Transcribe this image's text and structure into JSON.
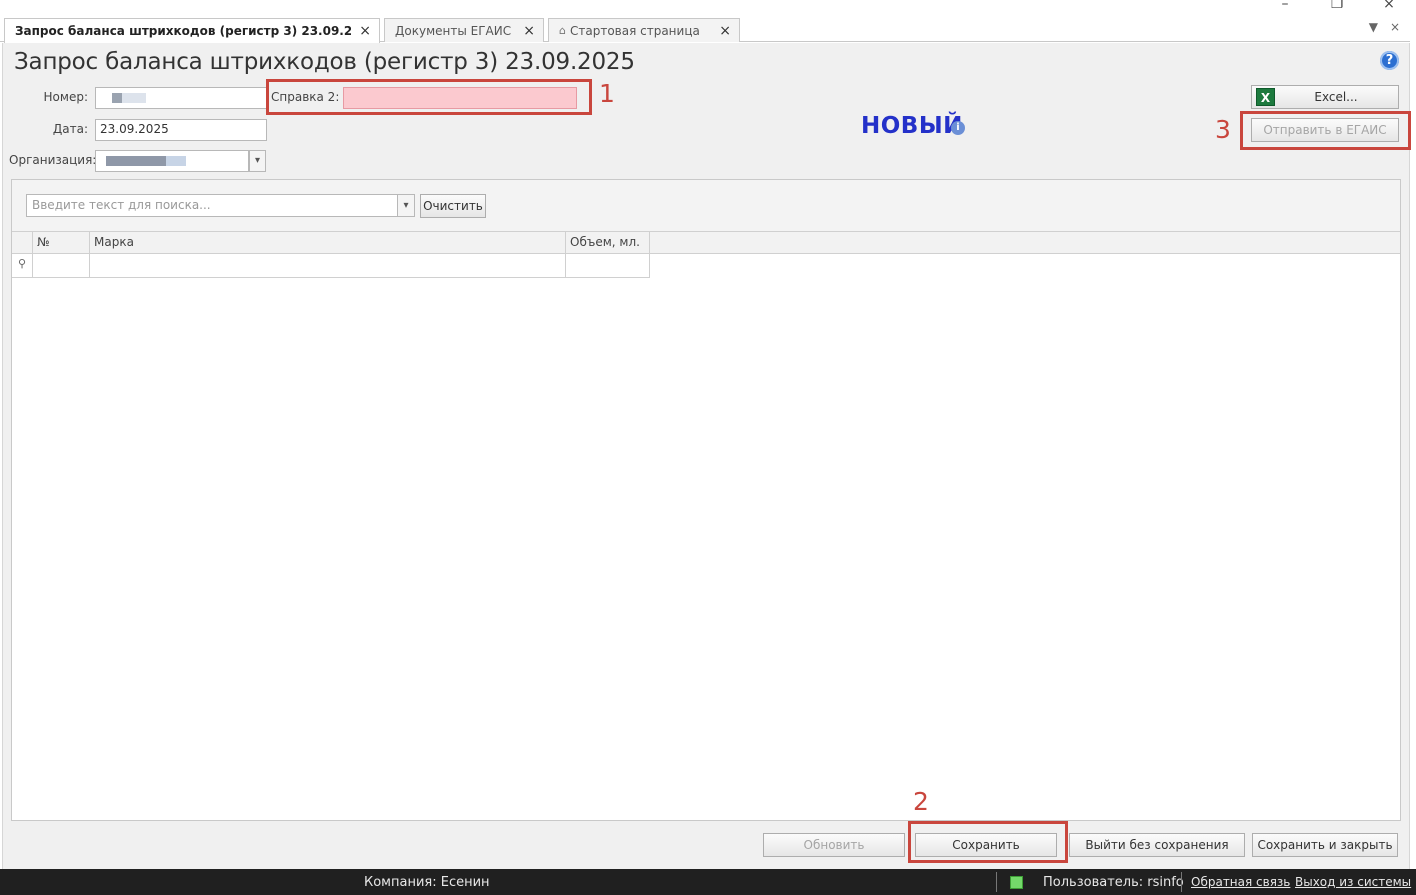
{
  "tabs": [
    {
      "label": "Запрос баланса штрихкодов (регистр 3) 23.09.2025",
      "close": "×",
      "active": true
    },
    {
      "label": "Документы ЕГАИС",
      "close": "×",
      "active": false
    },
    {
      "label": "Стартовая страница",
      "close": "×",
      "active": false,
      "icon": "home-icon"
    }
  ],
  "tabbar_controls": {
    "dropdown": "▼",
    "close": "×"
  },
  "window_controls": {
    "minimize": "–",
    "restore": "❐",
    "close": "×"
  },
  "page": {
    "title": "Запрос баланса штрихкодов (регистр 3) 23.09.2025",
    "help": "?"
  },
  "form": {
    "number_label": "Номер:",
    "spravka_label": "Справка 2:",
    "date_label": "Дата:",
    "date_value": "23.09.2025",
    "org_label": "Организация:",
    "dropdown_arrow": "▾"
  },
  "status": {
    "label": "НОВЫЙ",
    "info": "i",
    "color": "#2431c9"
  },
  "buttons": {
    "excel": "Excel...",
    "send_egais": "Отправить в ЕГАИС",
    "clear": "Очистить",
    "refresh": "Обновить",
    "save": "Сохранить",
    "exit_no_save": "Выйти без сохранения",
    "save_close": "Сохранить и закрыть"
  },
  "search": {
    "placeholder": "Введите текст для поиска...",
    "dropdown_arrow": "▾"
  },
  "table": {
    "columns": [
      "№",
      "Марка",
      "Объем, мл."
    ],
    "new_row_marker": "⚲"
  },
  "annotations": {
    "n1": "1",
    "n2": "2",
    "n3": "3",
    "color": "#c9463d"
  },
  "statusbar": {
    "company": "Компания: Есенин",
    "user": "Пользователь: rsinfo",
    "feedback": "Обратная связь",
    "logout": "Выход из системы"
  }
}
